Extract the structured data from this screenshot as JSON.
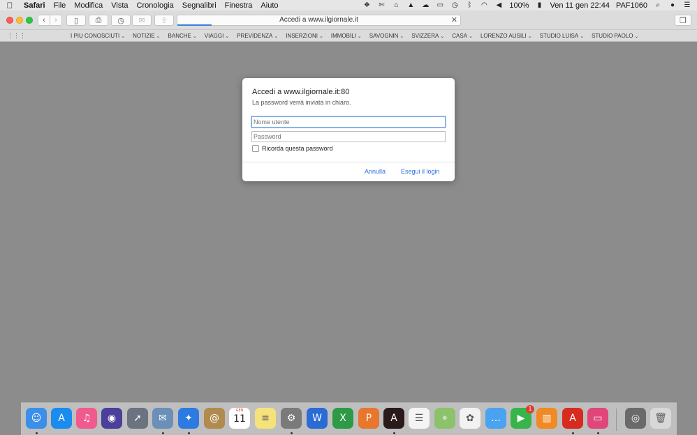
{
  "menubar": {
    "apple": "",
    "items": [
      "Safari",
      "File",
      "Modifica",
      "Vista",
      "Cronologia",
      "Segnalibri",
      "Finestra",
      "Aiuto"
    ],
    "battery": "100%",
    "datetime": "Ven 11 gen  22:44",
    "user": "PAF1060"
  },
  "toolbar": {
    "address_text": "Accedi a www.ilgiornale.it",
    "progress_fraction": 0.12
  },
  "favorites": [
    "I PIU CONOSCIUTI",
    "NOTIZIE",
    "BANCHE",
    "VIAGGI",
    "PREVIDENZA",
    "INSERZIONI",
    "IMMOBILI",
    "SAVOGNIN",
    "SVIZZERA",
    "CASA",
    "LORENZO AUSILI",
    "STUDIO LUISA",
    "STUDIO PAOLO"
  ],
  "dialog": {
    "title": "Accedi a www.ilgiornale.it:80",
    "subtitle": "La password verrà inviata in chiaro.",
    "username_placeholder": "Nome utente",
    "password_placeholder": "Password",
    "remember_label": "Ricorda questa password",
    "remember_checked": false,
    "cancel_label": "Annulla",
    "login_label": "Esegui il login"
  },
  "dock": {
    "calendar_month": "GEN",
    "calendar_day": "11",
    "facetime_badge": "1",
    "icons": [
      {
        "name": "finder-icon",
        "color": "#3c8fe8",
        "glyph": "☺",
        "running": true
      },
      {
        "name": "app-store-icon",
        "color": "#1a8cf0",
        "glyph": "A",
        "running": false
      },
      {
        "name": "itunes-icon",
        "color": "#f05a8e",
        "glyph": "♫",
        "running": false
      },
      {
        "name": "siri-icon",
        "color": "#4a3f9a",
        "glyph": "◉",
        "running": false
      },
      {
        "name": "launchpad-icon",
        "color": "#6b7280",
        "glyph": "➚",
        "running": false
      },
      {
        "name": "mail-app-icon",
        "color": "#6a8fb8",
        "glyph": "✉",
        "running": true
      },
      {
        "name": "safari-icon",
        "color": "#2d7be0",
        "glyph": "✦",
        "running": true
      },
      {
        "name": "contacts-icon",
        "color": "#b08a4e",
        "glyph": "@",
        "running": false
      },
      {
        "name": "calendar-icon",
        "color": "#ffffff",
        "glyph": "",
        "running": false
      },
      {
        "name": "notes-icon",
        "color": "#f6e27a",
        "glyph": "≡",
        "running": false
      },
      {
        "name": "system-preferences-icon",
        "color": "#7a7a7a",
        "glyph": "⚙",
        "running": true
      },
      {
        "name": "word-icon",
        "color": "#2b6bd6",
        "glyph": "W",
        "running": false
      },
      {
        "name": "excel-icon",
        "color": "#2e9a45",
        "glyph": "X",
        "running": false
      },
      {
        "name": "powerpoint-icon",
        "color": "#e8762d",
        "glyph": "P",
        "running": false
      },
      {
        "name": "acrobat-reader-icon",
        "color": "#2a1a1a",
        "glyph": "A",
        "running": true
      },
      {
        "name": "reminders-icon",
        "color": "#f4f4f4",
        "glyph": "☰",
        "running": false
      },
      {
        "name": "maps-icon",
        "color": "#8cc36a",
        "glyph": "⌖",
        "running": false
      },
      {
        "name": "photos-icon",
        "color": "#f2f2f2",
        "glyph": "✿",
        "running": false
      },
      {
        "name": "messages-icon",
        "color": "#4aa3f0",
        "glyph": "…",
        "running": false
      },
      {
        "name": "facetime-icon",
        "color": "#38b54a",
        "glyph": "▶",
        "running": false
      },
      {
        "name": "ibooks-icon",
        "color": "#f08a24",
        "glyph": "▥",
        "running": false
      },
      {
        "name": "acrobat-icon",
        "color": "#d62b1f",
        "glyph": "A",
        "running": true
      },
      {
        "name": "pink-app-icon",
        "color": "#e0467a",
        "glyph": "▭",
        "running": true
      },
      {
        "name": "screenshot-app-icon",
        "color": "#6a6a6a",
        "glyph": "◎",
        "running": false
      },
      {
        "name": "trash-icon",
        "color": "#d8d8d8",
        "glyph": "🗑",
        "running": false
      }
    ]
  }
}
